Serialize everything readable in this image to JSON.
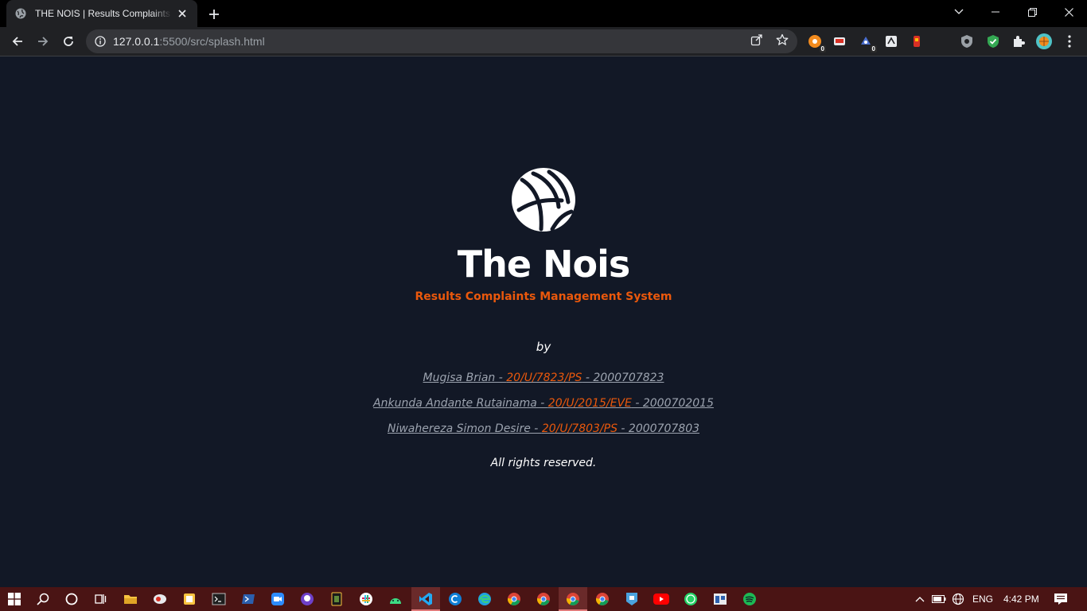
{
  "browser": {
    "tab_title": "THE NOIS | Results Complaints Management System",
    "url_host": "127.0.0.1",
    "url_rest": ":5500/src/splash.html",
    "extension_badges": [
      "0",
      "0"
    ]
  },
  "page": {
    "brand": "The Nois",
    "subtitle": "Results Complaints Management System",
    "by_label": "by",
    "authors": [
      {
        "name": "Mugisa Brian - ",
        "reg": "20/U/7823/PS",
        "student_no": " - 2000707823"
      },
      {
        "name": "Ankunda Andante Rutainama - ",
        "reg": "20/U/2015/EVE",
        "student_no": " - 2000702015"
      },
      {
        "name": "Niwahereza Simon Desire - ",
        "reg": "20/U/7803/PS",
        "student_no": " - 2000707803"
      }
    ],
    "rights": "All rights reserved.",
    "colors": {
      "background": "#121826",
      "accent": "#ea580c",
      "muted": "#9ca3af"
    }
  },
  "taskbar": {
    "language": "ENG",
    "time": "4:42 PM",
    "icons": [
      "windows-start",
      "search",
      "cortana",
      "task-view",
      "file-explorer",
      "app",
      "app",
      "terminal",
      "powershell",
      "zoom",
      "github-desktop",
      "app",
      "slack",
      "android-studio",
      "vscode",
      "app",
      "edge",
      "chrome",
      "chrome",
      "chrome-active",
      "chrome",
      "app",
      "youtube",
      "whatsapp",
      "app",
      "spotify"
    ]
  }
}
